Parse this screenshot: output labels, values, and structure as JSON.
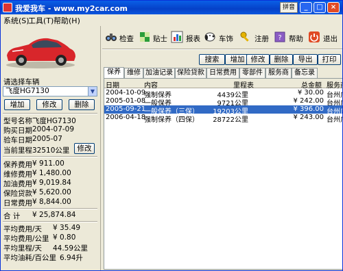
{
  "window": {
    "title": "我爱我车 - www.my2car.com",
    "ime": "拼音"
  },
  "menu": {
    "system": "系统(S)",
    "tools": "工具(T)",
    "help": "帮助(H)"
  },
  "toolbar": [
    {
      "label": "检查",
      "icon": "binoculars-icon"
    },
    {
      "label": "贴士",
      "icon": "puzzle-icon"
    },
    {
      "label": "报表",
      "icon": "report-chart-icon"
    },
    {
      "label": "车饰",
      "icon": "snoopy-icon"
    },
    {
      "label": "注册",
      "icon": "key-icon"
    },
    {
      "label": "帮助",
      "icon": "help-book-icon"
    },
    {
      "label": "退出",
      "icon": "exit-power-icon"
    }
  ],
  "actions": {
    "search": "搜索",
    "add": "增加",
    "edit": "修改",
    "delete": "删除",
    "export": "导出",
    "print": "打印"
  },
  "tabs": [
    "保养",
    "维修",
    "加油记录",
    "保险贷款",
    "日常费用",
    "零部件",
    "服务商",
    "备忘录"
  ],
  "left": {
    "select_label": "请选择车辆",
    "selected_car": "飞度HG7130",
    "buttons": {
      "add": "增加",
      "edit": "修改",
      "delete": "删除"
    },
    "info": [
      {
        "label": "型号名称",
        "value": "飞度HG7130"
      },
      {
        "label": "购买日期",
        "value": "2004-07-09"
      },
      {
        "label": "验车日期",
        "value": "2005-07"
      }
    ],
    "mileage": {
      "label": "当前里程",
      "value": "32510公里",
      "button": "修改"
    },
    "costs": [
      {
        "label": "保养费用",
        "value": "¥ 911.00"
      },
      {
        "label": "维修费用",
        "value": "¥ 1,480.00"
      },
      {
        "label": "加油费用",
        "value": "¥ 9,019.84"
      },
      {
        "label": "保险贷款",
        "value": "¥ 5,620.00"
      },
      {
        "label": "日常费用",
        "value": "¥ 8,844.00"
      }
    ],
    "total": {
      "label": "合  计",
      "value": "¥ 25,874.84"
    },
    "averages": [
      {
        "label": "平均费用/天",
        "value": "¥ 35.49"
      },
      {
        "label": "平均费用/公里",
        "value": "¥ 0.80"
      },
      {
        "label": "平均里程/天",
        "value": "44.59公里"
      },
      {
        "label": "平均油耗/百公里",
        "value": "6.94升"
      }
    ]
  },
  "table": {
    "columns": [
      "日期",
      "内容",
      "里程表",
      "总金额",
      "服务商"
    ],
    "rows": [
      {
        "date": "2004-10-09",
        "content": "强制保养",
        "mileage": "4439公里",
        "amount": "¥ 30.00",
        "provider": "台州广"
      },
      {
        "date": "2005-01-08",
        "content": "一般保养",
        "mileage": "9721公里",
        "amount": "¥ 242.00",
        "provider": "台州广"
      },
      {
        "date": "2005-09-21",
        "content": "一般保养（三保）",
        "mileage": "19203公里",
        "amount": "¥ 396.00",
        "provider": "台州广"
      },
      {
        "date": "2006-04-18",
        "content": "强制保养（四保）",
        "mileage": "28722公里",
        "amount": "¥ 243.00",
        "provider": "台州广"
      }
    ],
    "selected_index": 2
  },
  "colors": {
    "title_bar": "#0A5FE6",
    "selection": "#316AC5",
    "car_body": "#D8262B"
  }
}
